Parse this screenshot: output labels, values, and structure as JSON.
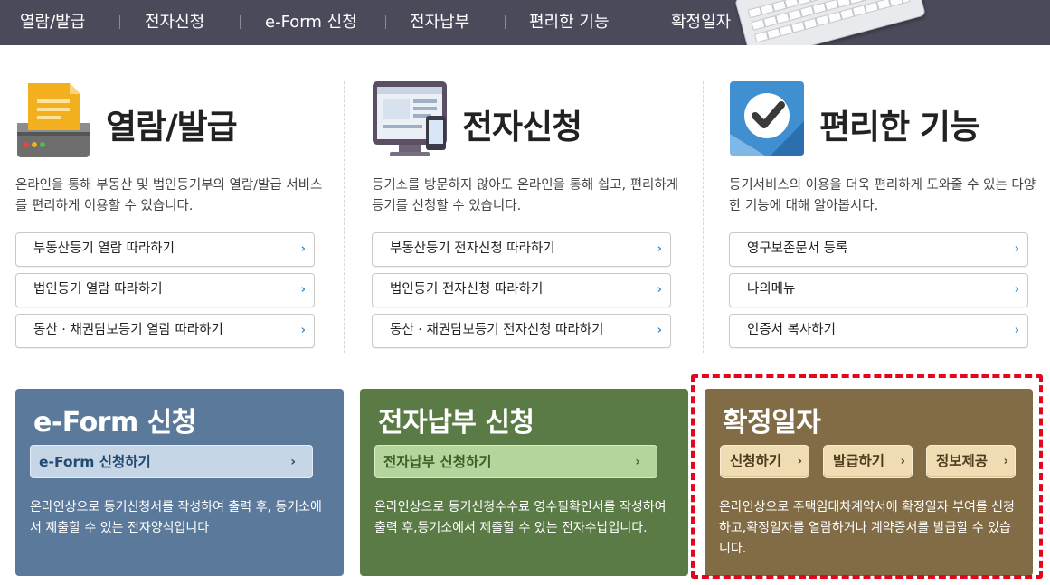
{
  "topnav": {
    "items": [
      "열람/발급",
      "전자신청",
      "e-Form 신청",
      "전자납부",
      "편리한 기능",
      "확정일자"
    ]
  },
  "columns": [
    {
      "title": "열람/발급",
      "icon": "printer-icon",
      "desc": "온라인을 통해 부동산 및 법인등기부의 열람/발급 서비스를 편리하게 이용할 수 있습니다.",
      "links": [
        "부동산등기 열람 따라하기",
        "법인등기 열람 따라하기",
        "동산 · 채권담보등기 열람 따라하기"
      ]
    },
    {
      "title": "전자신청",
      "icon": "monitor-icon",
      "desc": "등기소를 방문하지 않아도 온라인을 통해 쉽고, 편리하게 등기를 신청할 수 있습니다.",
      "links": [
        "부동산등기 전자신청 따라하기",
        "법인등기 전자신청 따라하기",
        "동산 · 채권담보등기 전자신청 따라하기"
      ]
    },
    {
      "title": "편리한 기능",
      "icon": "checkmark-icon",
      "desc": "등기서비스의 이용을 더욱 편리하게 도와줄 수 있는 다양한 기능에 대해 알아봅시다.",
      "links": [
        "영구보존문서 등록",
        "나의메뉴",
        "인증서 복사하기"
      ]
    }
  ],
  "panels": {
    "eform": {
      "title": "e-Form 신청",
      "button": "e-Form 신청하기",
      "desc": "온라인상으로 등기신청서를 작성하여 출력 후, 등기소에서 제출할 수 있는 전자양식입니다",
      "color": "#5b7a9b"
    },
    "pay": {
      "title": "전자납부 신청",
      "button": "전자납부 신청하기",
      "desc": "온라인상으로 등기신청수수료 영수필확인서를 작성하여 출력 후,등기소에서 제출할 수 있는 전자수납입니다.",
      "color": "#5b7b46"
    },
    "date": {
      "title": "확정일자",
      "buttons": [
        "신청하기",
        "발급하기",
        "정보제공"
      ],
      "desc": "온라인상으로 주택임대차계약서에 확정일자 부여를 신청하고,확정일자를 열람하거나 계약증서를 발급할 수 있습니다.",
      "color": "#826c45",
      "highlight_color": "#e3061d"
    }
  },
  "arrow": "›"
}
